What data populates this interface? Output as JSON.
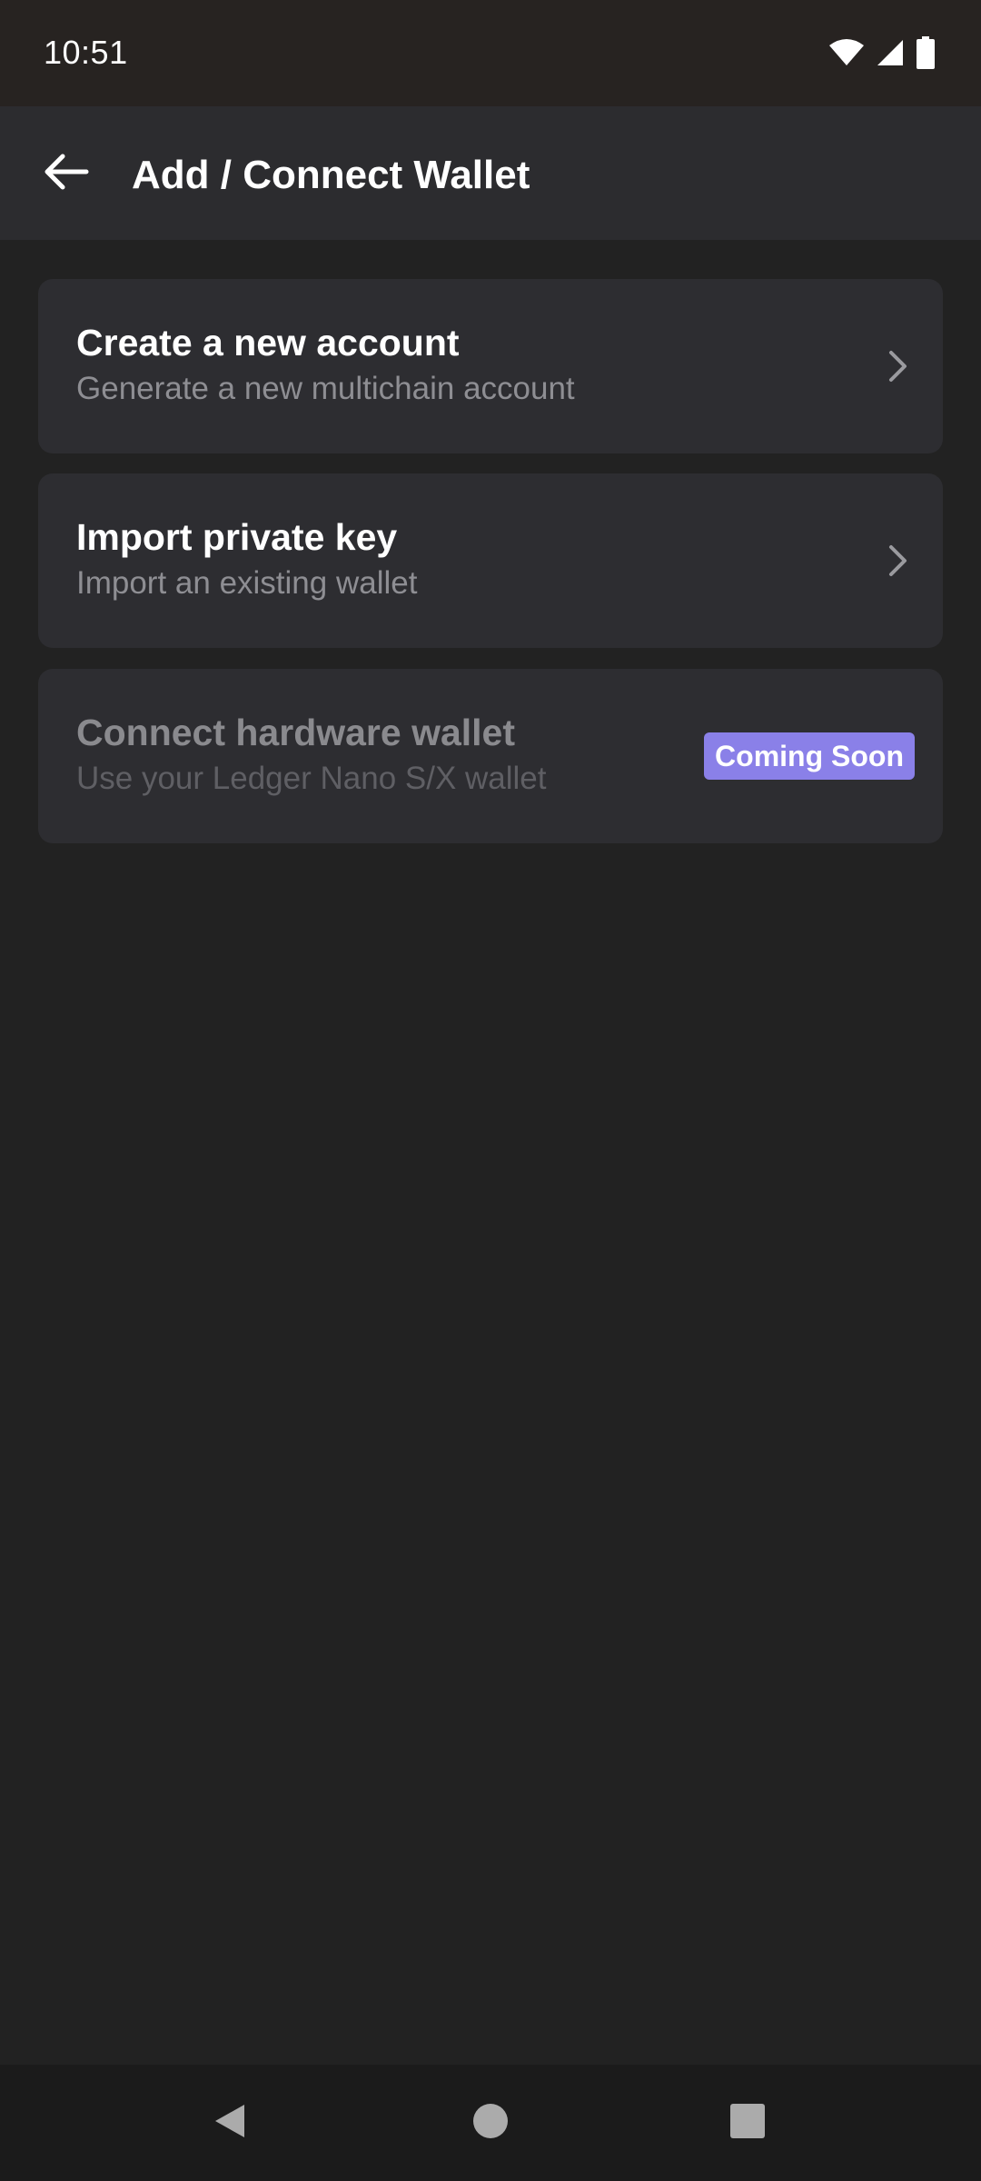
{
  "status_bar": {
    "time": "10:51",
    "icons": [
      "wifi-icon",
      "cell-signal-icon",
      "battery-icon"
    ]
  },
  "header": {
    "back_icon": "arrow-left-icon",
    "title": "Add / Connect Wallet"
  },
  "options": [
    {
      "title": "Create a new account",
      "subtitle": "Generate a new multichain account",
      "trailing_icon": "chevron-right-icon",
      "enabled": true
    },
    {
      "title": "Import private key",
      "subtitle": "Import an existing wallet",
      "trailing_icon": "chevron-right-icon",
      "enabled": true
    },
    {
      "title": "Connect hardware wallet",
      "subtitle": "Use your Ledger Nano S/X wallet",
      "badge": "Coming Soon",
      "enabled": false
    }
  ],
  "navigation_bar": {
    "buttons": [
      "back-triangle-icon",
      "home-circle-icon",
      "recents-square-icon"
    ]
  },
  "colors": {
    "background": "#222222",
    "status_bar": "#272321",
    "app_bar": "#2c2c2f",
    "card": "#2d2d31",
    "badge": "#8a80e8",
    "subtitle": "#8e8e93"
  }
}
